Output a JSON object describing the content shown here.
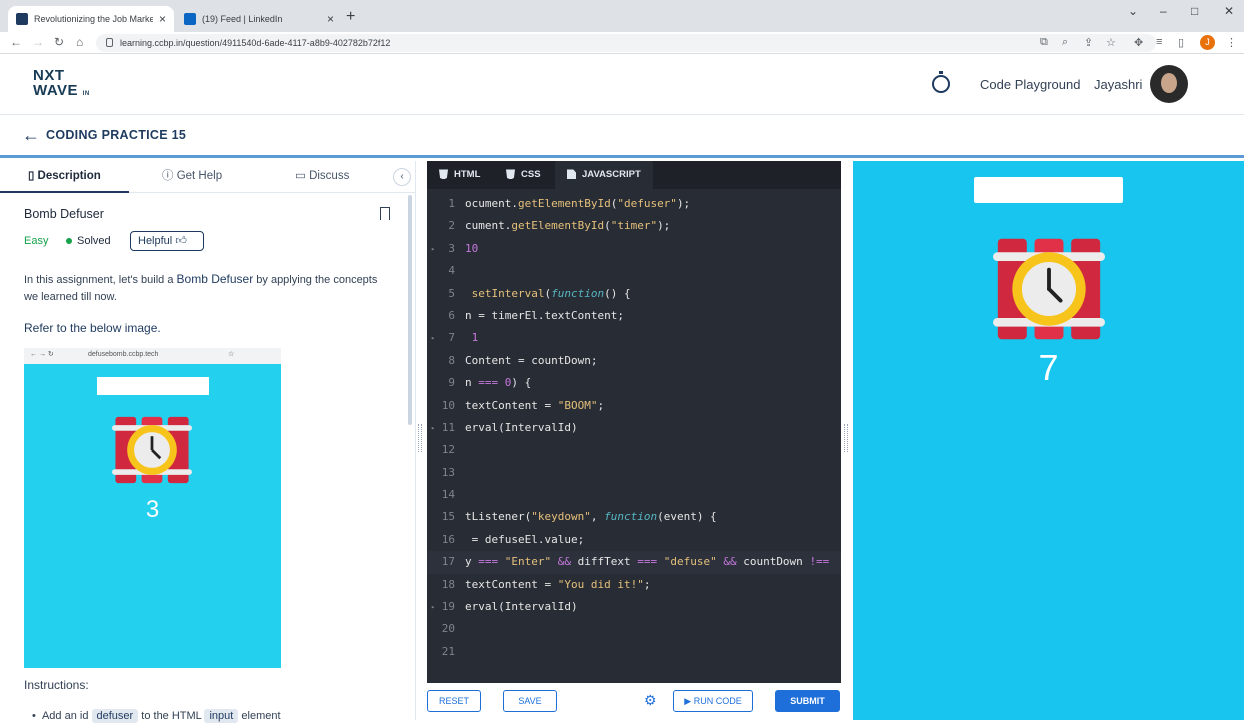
{
  "browser": {
    "tabs": [
      {
        "title": "Revolutionizing the Job Market |",
        "active": true
      },
      {
        "title": "(19) Feed | LinkedIn",
        "active": false
      }
    ],
    "url": "learning.ccbp.in/question/4911540d-6ade-4117-a8b9-402782b72f12",
    "profile_initial": "J"
  },
  "header": {
    "logo_line1": "NXT",
    "logo_line2": "WAVE",
    "logo_suffix": "IN",
    "code_playground": "Code Playground",
    "user_name": "Jayashri"
  },
  "subheader": {
    "back_arrow": "←",
    "title": "CODING PRACTICE 15"
  },
  "left": {
    "tabs": [
      "Description",
      "Get Help",
      "Discuss"
    ],
    "question_title": "Bomb Defuser",
    "difficulty": "Easy",
    "status": "Solved",
    "helpful": "Helpful",
    "intro_prefix": "In this assignment, let's build a ",
    "intro_bold": "Bomb Defuser",
    "intro_suffix": " by applying the concepts we learned till now.",
    "refer": "Refer to the below image.",
    "preview_url": "defusebomb.ccbp.tech",
    "preview_count": "3",
    "instructions": "Instructions:",
    "bullet_prefix": "Add an id",
    "bullet_chip1": "defuser",
    "bullet_mid": "to the HTML",
    "bullet_chip2": "input",
    "bullet_suffix": "element"
  },
  "editor": {
    "tabs": [
      "HTML",
      "CSS",
      "JAVASCRIPT"
    ],
    "lines": [
      {
        "n": "1",
        "t": "ocument.getElementById(\"defuser\");"
      },
      {
        "n": "2",
        "t": "cument.getElementById(\"timer\");"
      },
      {
        "n": "3",
        "t": "10"
      },
      {
        "n": "4",
        "t": ""
      },
      {
        "n": "5",
        "t": " setInterval(function() {"
      },
      {
        "n": "6",
        "t": "n = timerEl.textContent;"
      },
      {
        "n": "7",
        "t": " 1"
      },
      {
        "n": "8",
        "t": "Content = countDown;"
      },
      {
        "n": "9",
        "t": "n === 0) {"
      },
      {
        "n": "10",
        "t": "textContent = \"BOOM\";"
      },
      {
        "n": "11",
        "t": "erval(IntervalId)"
      },
      {
        "n": "12",
        "t": ""
      },
      {
        "n": "13",
        "t": ""
      },
      {
        "n": "14",
        "t": ""
      },
      {
        "n": "15",
        "t": "tListener(\"keydown\", function(event) {"
      },
      {
        "n": "16",
        "t": " = defuseEl.value;"
      },
      {
        "n": "17",
        "t": "y === \"Enter\" && diffText === \"defuse\" && countDown !=="
      },
      {
        "n": "18",
        "t": "textContent = \"You did it!\";"
      },
      {
        "n": "19",
        "t": "erval(IntervalId)"
      },
      {
        "n": "20",
        "t": ""
      },
      {
        "n": "21",
        "t": ""
      }
    ],
    "fold_lines": [
      "3",
      "7",
      "11",
      "19"
    ]
  },
  "actions": {
    "reset": "RESET",
    "save": "SAVE",
    "run": "▶ RUN CODE",
    "submit": "SUBMIT"
  },
  "output": {
    "countdown": "7"
  },
  "colors": {
    "output_bg": "#17c5ef",
    "accent": "#1e6fd9",
    "navy": "#1e3a5f"
  }
}
